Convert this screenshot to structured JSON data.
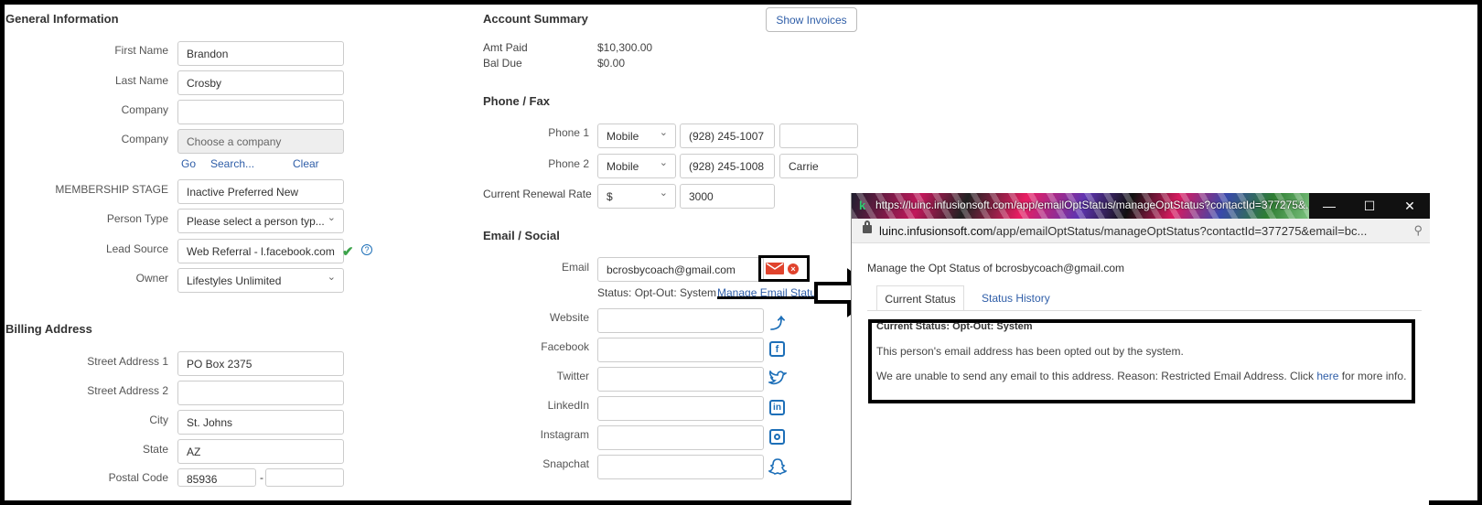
{
  "general": {
    "title": "General Information",
    "first_name_label": "First Name",
    "first_name": "Brandon",
    "last_name_label": "Last Name",
    "last_name": "Crosby",
    "company_label": "Company",
    "company": "",
    "company2_label": "Company",
    "company2_placeholder": "Choose a company",
    "go": "Go",
    "search": "Search...",
    "clear": "Clear",
    "membership_label": "MEMBERSHIP STAGE",
    "membership": "Inactive Preferred New",
    "person_type_label": "Person Type",
    "person_type": "Please select a person typ...",
    "lead_source_label": "Lead Source",
    "lead_source": "Web Referral - l.facebook.com",
    "owner_label": "Owner",
    "owner": "Lifestyles Unlimited"
  },
  "billing": {
    "title": "Billing Address",
    "street1_label": "Street Address 1",
    "street1": "PO Box 2375",
    "street2_label": "Street Address 2",
    "street2": "",
    "city_label": "City",
    "city": "St. Johns",
    "state_label": "State",
    "state": "AZ",
    "postal_label": "Postal Code",
    "postal": "85936",
    "postal_sep": "-"
  },
  "account": {
    "title": "Account Summary",
    "show_invoices": "Show Invoices",
    "amt_paid_label": "Amt Paid",
    "amt_paid": "$10,300.00",
    "bal_due_label": "Bal Due",
    "bal_due": "$0.00"
  },
  "phone": {
    "title": "Phone / Fax",
    "phone1_label": "Phone 1",
    "phone1_type": "Mobile",
    "phone1": "(928) 245-1007",
    "phone1_ext": "",
    "phone2_label": "Phone 2",
    "phone2_type": "Mobile",
    "phone2": "(928) 245-1008",
    "phone2_ext": "Carrie",
    "renewal_label": "Current Renewal Rate",
    "renewal_currency": "$",
    "renewal": "3000"
  },
  "email_social": {
    "title": "Email / Social",
    "email_label": "Email",
    "email": "bcrosbycoach@gmail.com",
    "status_text": "Status: Opt-Out: System",
    "manage_link": "Manage Email Status...",
    "website_label": "Website",
    "facebook_label": "Facebook",
    "twitter_label": "Twitter",
    "linkedin_label": "LinkedIn",
    "instagram_label": "Instagram",
    "snapchat_label": "Snapchat"
  },
  "popup": {
    "title_url": "https://luinc.infusionsoft.com/app/emailOptStatus/manageOptStatus?contactId=377275&...",
    "address_host": "luinc.infusionsoft.com",
    "address_path": "/app/emailOptStatus/manageOptStatus?contactId=377275&email=bc...",
    "heading": "Manage the Opt Status of bcrosbycoach@gmail.com",
    "tab_current": "Current Status",
    "tab_history": "Status History",
    "current_status": "Current Status: Opt-Out: System",
    "line1": "This person's email address has been opted out by the system.",
    "line2_pre": "We are unable to send any email to this address. Reason: Restricted Email Address. Click ",
    "line2_link": "here",
    "line2_post": " for more info."
  },
  "colors": {
    "link": "#2f5ea8",
    "social": "#1d6fb8",
    "alert": "#e0432d",
    "check": "#3ca34a"
  }
}
